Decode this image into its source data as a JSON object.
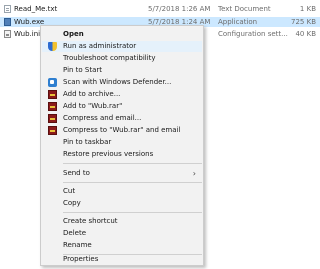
{
  "files": [
    {
      "name": "Read_Me.txt",
      "date": "5/7/2018 1:26 AM",
      "type": "Text Document",
      "size": "1 KB",
      "icon": "text-file-icon"
    },
    {
      "name": "Wub.exe",
      "date": "5/7/2018 1:24 AM",
      "type": "Application",
      "size": "725 KB",
      "icon": "exe-file-icon"
    },
    {
      "name": "Wub.ini",
      "date": "",
      "type": "Configuration sett...",
      "size": "40 KB",
      "icon": "ini-file-icon"
    }
  ],
  "context_menu": {
    "open": "Open",
    "run_as_admin": "Run as administrator",
    "troubleshoot": "Troubleshoot compatibility",
    "pin_start": "Pin to Start",
    "scan_defender": "Scan with Windows Defender...",
    "add_archive": "Add to archive...",
    "add_wub_rar": "Add to \"Wub.rar\"",
    "compress_email": "Compress and email...",
    "compress_wub_email": "Compress to \"Wub.rar\" and email",
    "pin_taskbar": "Pin to taskbar",
    "restore_versions": "Restore previous versions",
    "send_to": "Send to",
    "cut": "Cut",
    "copy": "Copy",
    "create_shortcut": "Create shortcut",
    "delete": "Delete",
    "rename": "Rename",
    "properties": "Properties"
  },
  "colors": {
    "selection": "#cce8ff",
    "menu_background": "#f2f2f2",
    "menu_hover": "#e5f1fb"
  }
}
